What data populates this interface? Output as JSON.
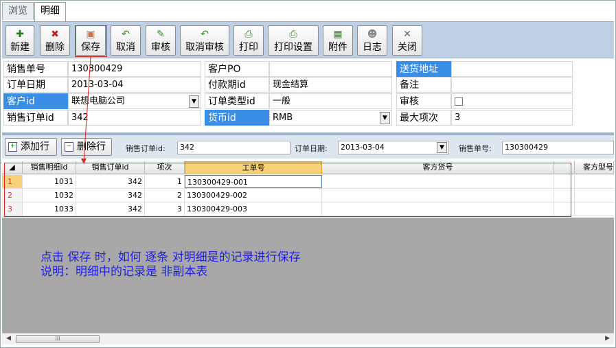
{
  "tabs": [
    "浏览",
    "明细"
  ],
  "toolbar": {
    "buttons": [
      {
        "label": "新建",
        "icon": "new-icon",
        "glyph": "✚",
        "color": "#2a7a2a"
      },
      {
        "label": "删除",
        "icon": "delete-icon",
        "glyph": "✖",
        "color": "#c02020"
      },
      {
        "label": "保存",
        "icon": "save-icon",
        "glyph": "▣",
        "color": "#d07040"
      },
      {
        "label": "取消",
        "icon": "undo-icon",
        "glyph": "↶",
        "color": "#3a8a2a"
      },
      {
        "label": "审核",
        "icon": "pencil-icon",
        "glyph": "✎",
        "color": "#3a8a2a"
      },
      {
        "label": "取消审核",
        "icon": "undo-icon",
        "glyph": "↶",
        "color": "#3a8a2a"
      },
      {
        "label": "打印",
        "icon": "printer-icon",
        "glyph": "⎙",
        "color": "#3a8a2a"
      },
      {
        "label": "打印设置",
        "icon": "printer-icon",
        "glyph": "⎙",
        "color": "#3a8a2a"
      },
      {
        "label": "附件",
        "icon": "grid-icon",
        "glyph": "▦",
        "color": "#3a8a2a"
      },
      {
        "label": "日志",
        "icon": "user-icon",
        "glyph": "☻",
        "color": "#888888"
      },
      {
        "label": "关闭",
        "icon": "close-icon",
        "glyph": "✕",
        "color": "#666666"
      }
    ]
  },
  "form": {
    "sale_no_label": "销售单号",
    "sale_no": "130300429",
    "order_date_label": "订单日期",
    "order_date": "2013-03-04",
    "customer_label": "客户id",
    "customer": "联想电脑公司",
    "sale_order_label": "销售订单id",
    "sale_order": "342",
    "customer_po_label": "客户PO",
    "customer_po": "",
    "pay_term_label": "付款期id",
    "pay_term": "现金结算",
    "order_type_label": "订单类型id",
    "order_type": "一般",
    "currency_label": "货币id",
    "currency": "RMB",
    "ship_addr_label": "送货地址",
    "ship_addr": "",
    "remark_label": "备注",
    "remark": "",
    "audit_label": "审核",
    "max_items_label": "最大项次",
    "max_items": "3"
  },
  "subbar": {
    "add_row": "添加行",
    "del_row": "删除行",
    "order_id_label": "销售订单id:",
    "order_id": "342",
    "order_date_label": "订单日期:",
    "order_date": "2013-03-04",
    "sale_no_label": "销售单号:",
    "sale_no": "130300429"
  },
  "grid": {
    "columns": [
      "销售明细id",
      "销售订单id",
      "项次",
      "工单号",
      "客方货号",
      "客方型号"
    ],
    "rows": [
      {
        "rn": "1",
        "detail_id": "1031",
        "order_id": "342",
        "item": "1",
        "work_no": "130300429-001"
      },
      {
        "rn": "2",
        "detail_id": "1032",
        "order_id": "342",
        "item": "2",
        "work_no": "130300429-002"
      },
      {
        "rn": "3",
        "detail_id": "1033",
        "order_id": "342",
        "item": "3",
        "work_no": "130300429-003"
      }
    ]
  },
  "notes": {
    "line1": "点击  保存  时，如何   逐条   对明细是的记录进行保存",
    "line2": "说明：明细中的记录是  非副本表"
  },
  "scroll": {
    "thumb": "III"
  },
  "colors": {
    "accent_blue": "#3a8ee6",
    "annotation_red": "#dd2222",
    "note_blue": "#2020e0"
  }
}
